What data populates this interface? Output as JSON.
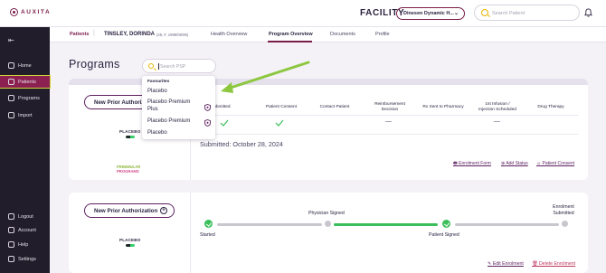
{
  "brand": {
    "logo_text": "AUXITA"
  },
  "header": {
    "facility_label": "FACILITY",
    "facility_value": "Dinesen Dynamic H...",
    "search_placeholder": "Search Patient"
  },
  "sidebar": {
    "items": [
      {
        "label": "Home",
        "active": false
      },
      {
        "label": "Patients",
        "active": true
      },
      {
        "label": "Programs",
        "active": false
      },
      {
        "label": "Import",
        "active": false
      },
      {
        "label": "Logout",
        "active": false
      },
      {
        "label": "Account",
        "active": false
      },
      {
        "label": "Help",
        "active": false
      },
      {
        "label": "Settings",
        "active": false
      }
    ]
  },
  "breadcrumb": {
    "link": "Patients",
    "patient_name": "TINSLEY, DORINDA",
    "patient_meta": "(25, F, 1999/05/09)"
  },
  "tabs": [
    {
      "label": "Health Overview",
      "active": false
    },
    {
      "label": "Program Overview",
      "active": true
    },
    {
      "label": "Documents",
      "active": false
    },
    {
      "label": "Profile",
      "active": false
    }
  ],
  "page": {
    "title": "Programs",
    "psp_search_placeholder": "Search PSP"
  },
  "dropdown": {
    "heading": "Favourites",
    "items": [
      "Placebo",
      "Placebo Premium Plus",
      "Placebo Premium",
      "Placebo"
    ]
  },
  "program1": {
    "button_label": "New Prior Authorization",
    "logo_text": "PLACEBO",
    "logo2_line1": "FREEMULAR",
    "logo2_line2": "PROGRAMS",
    "columns": [
      "Enrolment Submitted",
      "Patient Consent",
      "Contact Patient",
      "Reimbursement Decision",
      "Rx Sent to Pharmacy",
      "1st Infusion / Injection Scheduled",
      "Drug Therapy"
    ],
    "column_display": [
      "ment Submitted",
      "Patient Consent",
      "Contact Patient",
      "Reimbursement\nDecision",
      "Rx Sent to Pharmacy",
      "1st Infusion /\nInjection Scheduled",
      "Drug Therapy"
    ],
    "dash": "—",
    "submitted_text": "Submitted: October 28, 2024",
    "links": [
      "Enrolment Form",
      "Add Status",
      "Patient Consent"
    ]
  },
  "program2": {
    "button_label": "New Prior Authorization",
    "logo_text": "PLACEBO",
    "steps": [
      {
        "label": "Started",
        "done": true
      },
      {
        "label": "Physician Signed",
        "done": false
      },
      {
        "label": "Patient Signed",
        "done": true
      },
      {
        "label": "Enrolment Submitted",
        "done": false
      }
    ],
    "edit_label": "Edit Enrolment",
    "delete_label": "Delete Enrolment"
  },
  "colors": {
    "brand": "#7a1e4a",
    "success": "#3bbf5b",
    "sidebar_bg": "#221d2b",
    "annotation_arrow": "#8dc63f"
  }
}
